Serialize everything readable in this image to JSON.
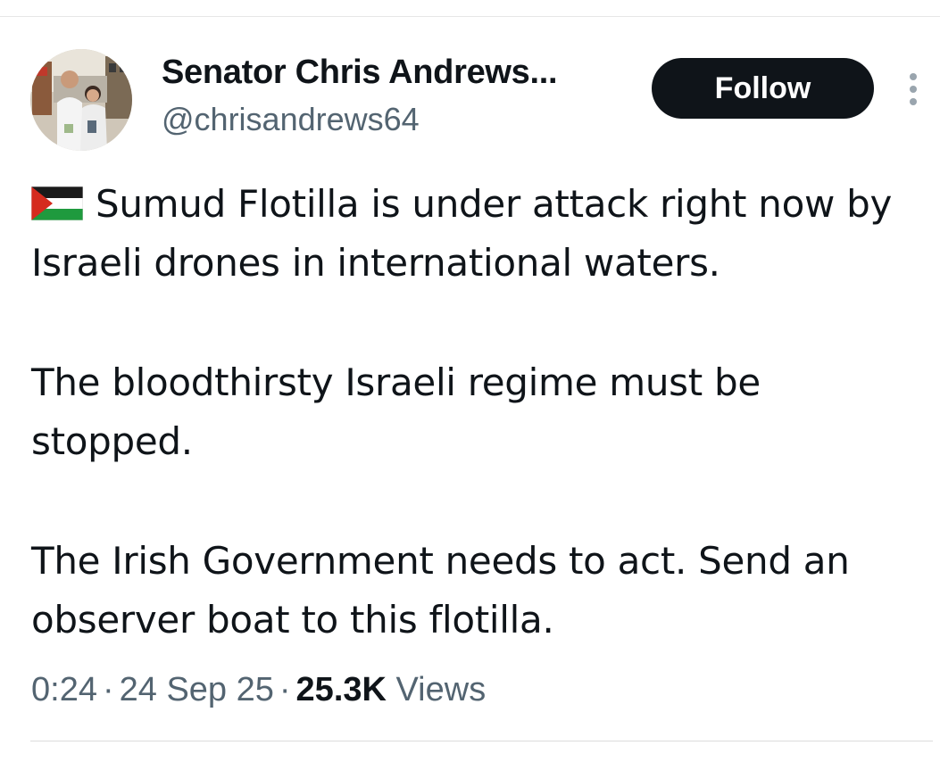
{
  "author": {
    "display_name": "Senator Chris Andrews...",
    "handle": "@chrisandrews64",
    "avatar_icon": "profile-photo"
  },
  "actions": {
    "follow_label": "Follow",
    "more_icon": "more-vertical-icon"
  },
  "tweet": {
    "flag_icon": "palestine-flag-icon",
    "paragraphs": [
      "Sumud Flotilla is under attack right now by Israeli drones in international waters.",
      "The bloodthirsty Israeli regime must be stopped.",
      "The Irish Government needs to act. Send an observer boat to this flotilla."
    ]
  },
  "meta": {
    "time": "0:24",
    "separator": "·",
    "date": "24 Sep 25",
    "views_count": "25.3K",
    "views_label": "Views"
  },
  "colors": {
    "text_primary": "#0f1419",
    "text_secondary": "#536471",
    "follow_bg": "#0f1419",
    "follow_text": "#ffffff"
  }
}
